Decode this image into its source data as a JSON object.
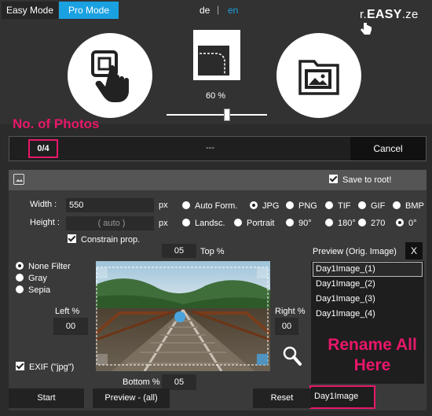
{
  "header": {
    "easy_mode": "Easy Mode",
    "pro_mode": "Pro Mode",
    "lang_de": "de",
    "lang_sep": "|",
    "lang_en": "en",
    "logo_prefix": "r.",
    "logo_bold": "EASY",
    "logo_suffix": ".ze",
    "resize_percent": "60 %",
    "slider_value_percent": 60
  },
  "annotations": {
    "photos": "No. of Photos",
    "rename_line1": "Rename All",
    "rename_line2": "Here"
  },
  "progress": {
    "count": "0/4",
    "status": "---",
    "cancel": "Cancel"
  },
  "options": {
    "save_to_root": "Save to root!",
    "width_label": "Width :",
    "width_value": "550",
    "height_label": "Height :",
    "height_value": "( auto )",
    "unit_px": "px",
    "constrain": "Constrain prop.",
    "format_opts": [
      "Auto Form.",
      "JPG",
      "PNG",
      "TIF",
      "GIF",
      "BMP"
    ],
    "orient_opts": [
      "Landsc.",
      "Portrait",
      "90°",
      "180°",
      "270",
      "0°"
    ],
    "filters": [
      "None Filter",
      "Gray",
      "Sepia"
    ],
    "left_label": "Left %",
    "left_value": "00",
    "right_label": "Right %",
    "right_value": "00",
    "top_label": "Top %",
    "top_value": "05",
    "bottom_label": "Bottom %",
    "bottom_value": "05",
    "exif": "EXIF (\"jpg\")"
  },
  "preview": {
    "title": "Preview (Orig. Image)",
    "close": "X",
    "items": [
      "Day1Image_(1)",
      "Day1Image_(2)",
      "Day1Image_(3)",
      "Day1Image_(4)"
    ],
    "rename_value": "Day1Image"
  },
  "buttons": {
    "start": "Start",
    "preview_all": "Preview - (all)",
    "reset": "Reset"
  },
  "colors": {
    "accent": "#1aa1e1",
    "annotation": "#e8176a"
  }
}
